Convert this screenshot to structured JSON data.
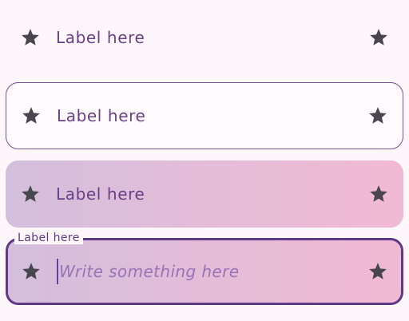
{
  "fields": [
    {
      "variant": "plain",
      "label": "Label here",
      "leading_icon": "star-icon",
      "trailing_icon": "star-icon"
    },
    {
      "variant": "outlined",
      "label": "Label here",
      "leading_icon": "star-icon",
      "trailing_icon": "star-icon"
    },
    {
      "variant": "filled",
      "label": "Label here",
      "leading_icon": "star-icon",
      "trailing_icon": "star-icon"
    },
    {
      "variant": "focused",
      "floating_label": "Label here",
      "value": "",
      "placeholder": "Write something here",
      "leading_icon": "star-icon",
      "trailing_icon": "star-icon"
    }
  ],
  "colors": {
    "icon": "#4a4650",
    "label": "#6a3f86",
    "outline": "#7a4f8e",
    "focus_outline": "#5e3a85",
    "gradient_start": "#d3bfdc",
    "gradient_end": "#f1bad4",
    "background": "#fdf7fc"
  }
}
